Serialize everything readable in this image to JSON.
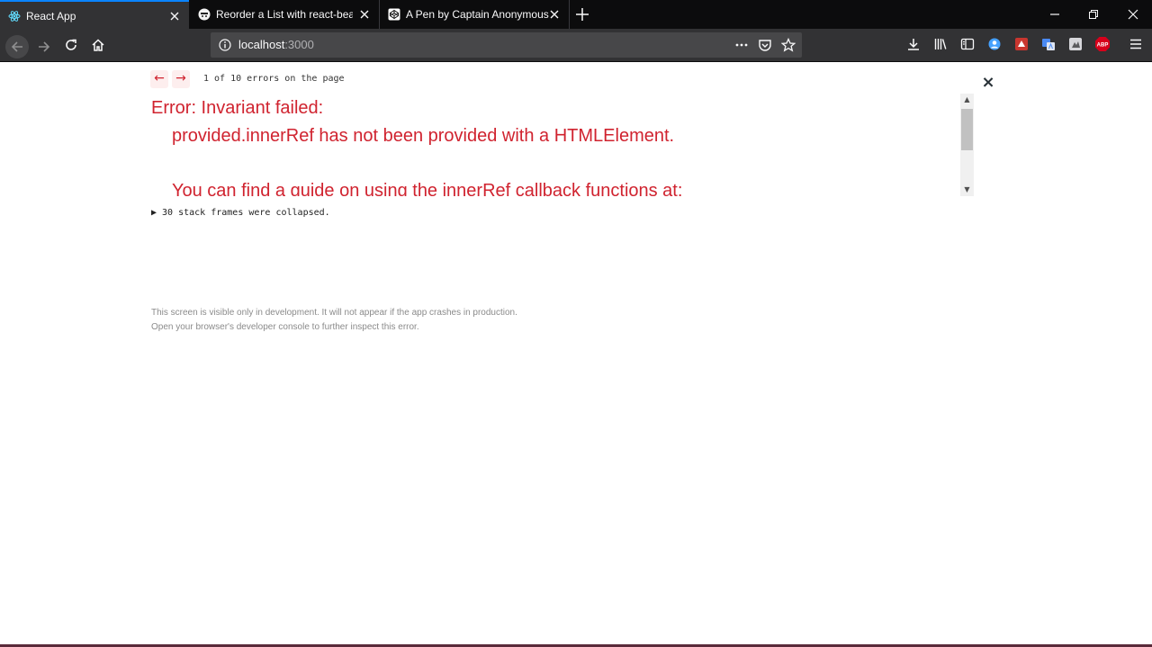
{
  "browser": {
    "tabs": [
      {
        "title": "React App",
        "active": true,
        "favicon": "react-logo-icon"
      },
      {
        "title": "Reorder a List with react-beautiful-dnd",
        "active": false,
        "favicon": "egghead-icon"
      },
      {
        "title": "A Pen by Captain Anonymous",
        "active": false,
        "favicon": "codepen-icon"
      }
    ],
    "address": {
      "host": "localhost",
      "port": ":3000"
    }
  },
  "overlay": {
    "prev_arrow": "←",
    "next_arrow": "→",
    "error_count": "1 of 10 errors on the page",
    "close_glyph": "×",
    "error_title": "Error: Invariant failed:",
    "error_lines": [
      "provided.innerRef has not been provided with a HTMLElement.",
      "You can find a guide on using the innerRef callback functions at:"
    ],
    "stack_toggle": "▶ 30 stack frames were collapsed.",
    "footer": [
      "This screen is visible only in development. It will not appear if the app crashes in production.",
      "Open your browser's developer console to further inspect this error."
    ]
  },
  "colors": {
    "error_red": "#d0232f",
    "tab_accent": "#0a84ff",
    "abp_red": "#d7001b"
  }
}
